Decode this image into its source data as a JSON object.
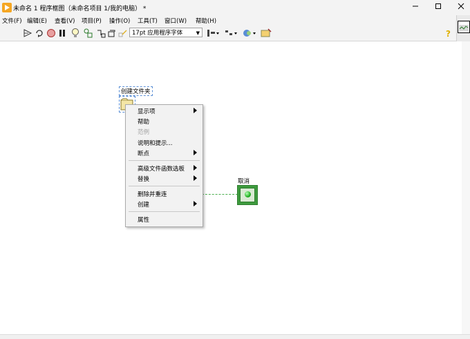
{
  "window": {
    "title": "未命名 1 程序框图（未命名项目 1/我的电脑） *",
    "minimize_icon": "minimize-icon",
    "maximize_icon": "maximize-icon",
    "close_icon": "close-icon"
  },
  "menubar": {
    "items": [
      "文件(F)",
      "编辑(E)",
      "查看(V)",
      "项目(P)",
      "操作(O)",
      "工具(T)",
      "窗口(W)",
      "帮助(H)"
    ]
  },
  "toolbar": {
    "font_selector": "17pt 应用程序字体",
    "icons": [
      "run-arrow-icon",
      "run-continuously-icon",
      "abort-icon",
      "pause-icon",
      "highlight-execution-icon",
      "retain-wire-values-icon",
      "step-into-icon",
      "step-over-icon",
      "step-out-icon",
      "align-objects-icon",
      "distribute-objects-icon",
      "reorder-icon",
      "cleanup-diagram-icon",
      "help-icon"
    ]
  },
  "diagram": {
    "node_label": "创建文件夹",
    "cancel_label": "取消"
  },
  "context_menu": {
    "items": [
      {
        "label": "显示项",
        "submenu": true,
        "enabled": true
      },
      {
        "label": "帮助",
        "submenu": false,
        "enabled": true
      },
      {
        "label": "范例",
        "submenu": false,
        "enabled": false
      },
      {
        "label": "说明和提示...",
        "submenu": false,
        "enabled": true
      },
      {
        "label": "断点",
        "submenu": true,
        "enabled": true
      },
      {
        "label": "高级文件函数选板",
        "submenu": true,
        "enabled": true
      },
      {
        "label": "替换",
        "submenu": true,
        "enabled": true
      },
      {
        "label": "删除并重连",
        "submenu": false,
        "enabled": true
      },
      {
        "label": "创建",
        "submenu": true,
        "enabled": true
      },
      {
        "label": "属性",
        "submenu": false,
        "enabled": true
      }
    ]
  },
  "colors": {
    "wire": "#4caf50",
    "terminal": "#3e9b3e",
    "selection": "#5b8fd6"
  }
}
